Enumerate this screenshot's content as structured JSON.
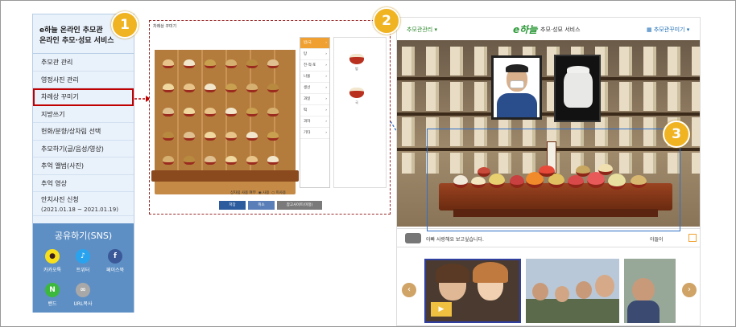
{
  "sidebar": {
    "title_line1": "e하늘 온라인 추모관",
    "title_line2": "온라인 추모·성묘 서비스",
    "items": [
      {
        "label": "추모관 관리"
      },
      {
        "label": "영정사진 관리"
      },
      {
        "label": "차례상 꾸미기",
        "selected": true
      },
      {
        "label": "지방쓰기"
      },
      {
        "label": "헌화/분향/상차림 선택"
      },
      {
        "label": "추모하기(글/음성/영상)"
      },
      {
        "label": "추억 앨범(사진)"
      },
      {
        "label": "추억 영상"
      },
      {
        "label": "안치사진 신청",
        "sub": "(2021.01.18 ~ 2021.01.19)"
      }
    ],
    "share": {
      "title": "공유하기(SNS)",
      "buttons": [
        {
          "label": "카카오톡",
          "icon": "kakaotalk-icon",
          "glyph": "●",
          "color": "#f7e01b",
          "fg": "#3c1e1e"
        },
        {
          "label": "트위터",
          "icon": "twitter-icon",
          "glyph": "🐦",
          "color": "#2aa3ef",
          "fg": "#fff"
        },
        {
          "label": "페이스북",
          "icon": "facebook-icon",
          "glyph": "f",
          "color": "#3b5998",
          "fg": "#fff"
        },
        {
          "label": "밴드",
          "icon": "band-icon",
          "glyph": "N",
          "color": "#3cb83c",
          "fg": "#fff"
        },
        {
          "label": "URL복사",
          "icon": "link-icon",
          "glyph": "🔗",
          "color": "#a8a8a8",
          "fg": "#fff"
        }
      ]
    }
  },
  "panel2": {
    "title": "차례상 꾸미기",
    "categories": [
      {
        "label": "밥/국",
        "on": true
      },
      {
        "label": "탕"
      },
      {
        "label": "전·적·포"
      },
      {
        "label": "나물"
      },
      {
        "label": "생선"
      },
      {
        "label": "과일"
      },
      {
        "label": "떡"
      },
      {
        "label": "과자"
      },
      {
        "label": "기타"
      }
    ],
    "items": [
      {
        "label": "밥"
      },
      {
        "label": "국"
      }
    ],
    "option_label": "상차림 사용 여부",
    "option_yes": "사용",
    "option_no": "미사용",
    "buttons": [
      {
        "label": "저장",
        "color": "#2c5b9e"
      },
      {
        "label": "취소",
        "color": "#5a7fb8"
      },
      {
        "label": "참고사이트(미정)",
        "color": "#7a7a7a"
      }
    ]
  },
  "right": {
    "nav_left": "추모관관리",
    "logo": "e하늘",
    "service": "추모·성묘 서비스",
    "nav_right": "추모관꾸미기",
    "message": "아빠 사랑해요 보고싶습니다.",
    "message_author": "아들이"
  },
  "badges": [
    "1",
    "2",
    "3"
  ],
  "colors": {
    "accent": "#f0b322",
    "highlight_red": "#c00000",
    "highlight_blue": "#2f6fc8",
    "sidebar_bg": "#e9f1fb",
    "share_bg": "#5e8fc4"
  }
}
